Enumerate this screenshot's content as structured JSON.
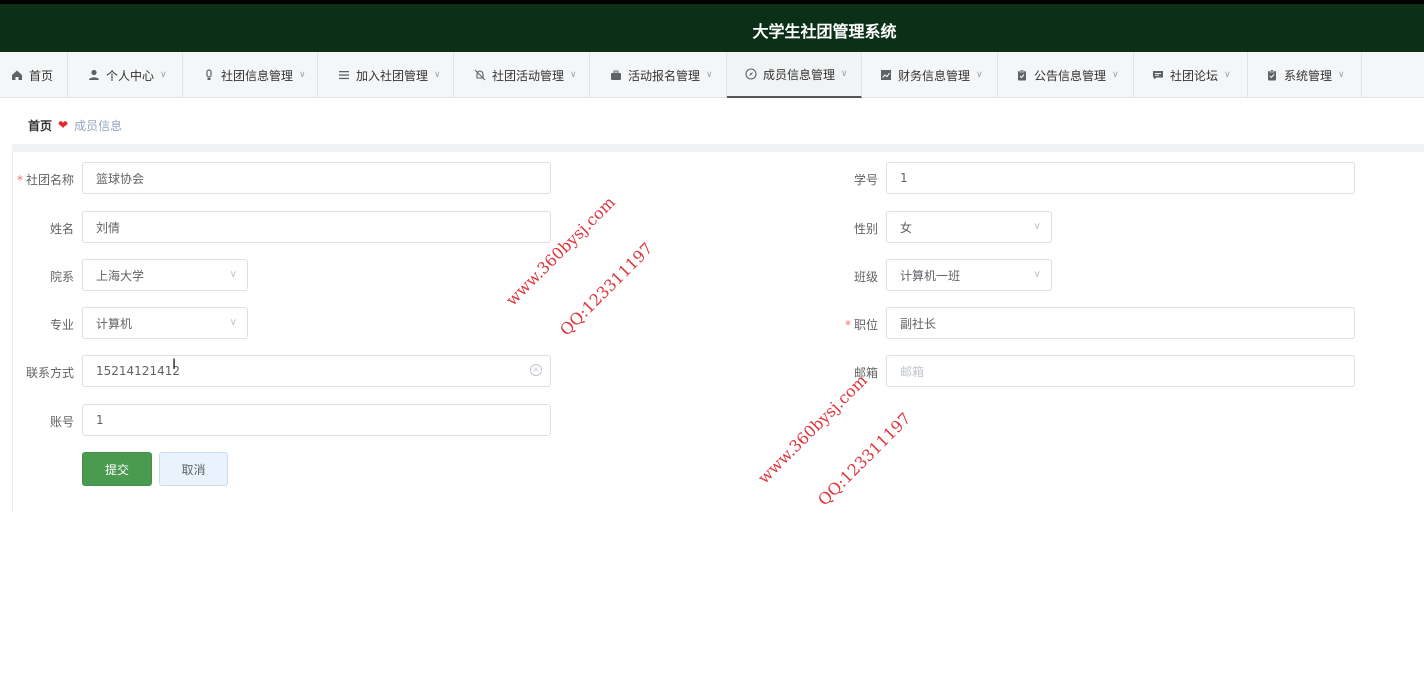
{
  "app": {
    "title": "大学生社团管理系统"
  },
  "nav": {
    "items": [
      {
        "label": "首页",
        "icon": "home-icon"
      },
      {
        "label": "个人中心",
        "icon": "user-icon"
      },
      {
        "label": "社团信息管理",
        "icon": "lightbulb-icon"
      },
      {
        "label": "加入社团管理",
        "icon": "list-icon"
      },
      {
        "label": "社团活动管理",
        "icon": "bell-off-icon"
      },
      {
        "label": "活动报名管理",
        "icon": "briefcase-icon"
      },
      {
        "label": "成员信息管理",
        "icon": "compass-icon"
      },
      {
        "label": "财务信息管理",
        "icon": "chart-icon"
      },
      {
        "label": "公告信息管理",
        "icon": "clipboard-icon"
      },
      {
        "label": "社团论坛",
        "icon": "chat-icon"
      },
      {
        "label": "系统管理",
        "icon": "checklist-icon"
      }
    ],
    "active_index": 6
  },
  "breadcrumb": {
    "home": "首页",
    "current": "成员信息"
  },
  "form": {
    "club_name": {
      "label": "社团名称",
      "value": "篮球协会"
    },
    "student_id": {
      "label": "学号",
      "value": "1"
    },
    "name": {
      "label": "姓名",
      "value": "刘倩"
    },
    "gender": {
      "label": "性别",
      "value": "女"
    },
    "department": {
      "label": "院系",
      "value": "上海大学"
    },
    "class": {
      "label": "班级",
      "value": "计算机一班"
    },
    "major": {
      "label": "专业",
      "value": "计算机"
    },
    "position": {
      "label": "职位",
      "value": "副社长"
    },
    "contact": {
      "label": "联系方式",
      "value": "15214121412"
    },
    "email": {
      "label": "邮箱",
      "placeholder": "邮箱"
    },
    "account": {
      "label": "账号",
      "value": "1"
    },
    "submit_label": "提交",
    "cancel_label": "取消"
  },
  "watermark": {
    "site": "www.360bysj.com",
    "qq": "QQ:123311197"
  },
  "colors": {
    "topbar": "#0b3017",
    "primary": "#4a9a4f",
    "required": "#f56c6c"
  }
}
